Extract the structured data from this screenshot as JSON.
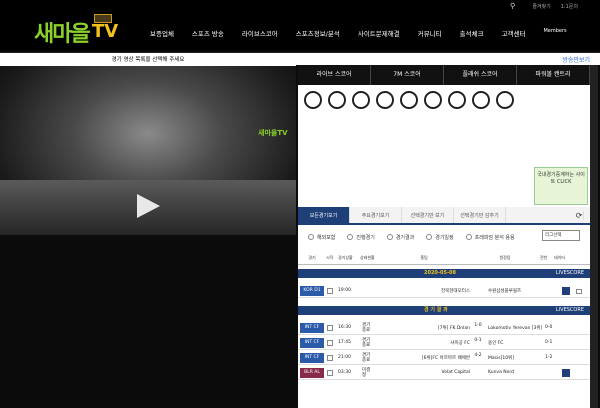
{
  "topbar": {
    "links": [
      "즐겨찾기",
      "1:1문의"
    ]
  },
  "logo": {
    "text_ko": "새마을",
    "text_tv": "TV"
  },
  "nav": {
    "items": [
      "보증업체",
      "스포츠 방송",
      "라이브스코어",
      "스포츠정보/분석",
      "사이트문제해결",
      "커뮤니티",
      "출석체크",
      "고객센터"
    ],
    "members": "Members"
  },
  "subbar": {
    "right_link": "방송만보기"
  },
  "player": {
    "caption": "경기 영상 목록을 선택해 주세요",
    "watermark": "새마을TV"
  },
  "score_tabs": [
    "라이브 스코어",
    "7M 스코어",
    "플래쉬 스코어",
    "파워볼 캔트리"
  ],
  "ad": {
    "text": "국내경기중계하는 사이트 CLICK"
  },
  "sub_tabs": [
    "모든경기보기",
    "주요경기보기",
    "선택경기만 보기",
    "선택경기만 감추기"
  ],
  "filters": [
    "해외포함",
    "진행경기",
    "경기결과",
    "경기일정",
    "프레피엄 분석 용용"
  ],
  "select_label": "리그선택",
  "columns": [
    "경기",
    "시작",
    "경기상황",
    "상태현황",
    "홈팀",
    "원정팀",
    "전반",
    "데이터"
  ],
  "date_bar": {
    "date": "2020-05-08",
    "label": "LIVESCORE"
  },
  "upcoming": [
    {
      "league": "KOR D1",
      "time": "19:00",
      "home": "전북현대모터스",
      "away": "수원삼성블루윙즈"
    }
  ],
  "results_bar": {
    "title": "경 기 결 과",
    "label": "LIVESCORE"
  },
  "results": [
    {
      "league": "INT CF",
      "time": "16:30",
      "status": "경기종료",
      "home": "[7위] FK Dnlan",
      "score": "1-0",
      "away": "Lokomotiv Yerevan [3위]",
      "half": "0-0"
    },
    {
      "league": "INT CF",
      "time": "17:45",
      "status": "경기종료",
      "home": "샤미공 FC",
      "score": "0-1",
      "away": "용인 FC",
      "half": "0-1"
    },
    {
      "league": "INT CF",
      "time": "21:00",
      "status": "경기종료",
      "home": "[6위]FC 아르마르 배에반",
      "score": "4-2",
      "away": "Masis[10위]",
      "half": "1-2"
    },
    {
      "league": "BLR AL",
      "time": "03:30",
      "status": "미결정",
      "home": "Volat Capital",
      "score": "",
      "away": "Kunva Nord",
      "half": ""
    }
  ]
}
